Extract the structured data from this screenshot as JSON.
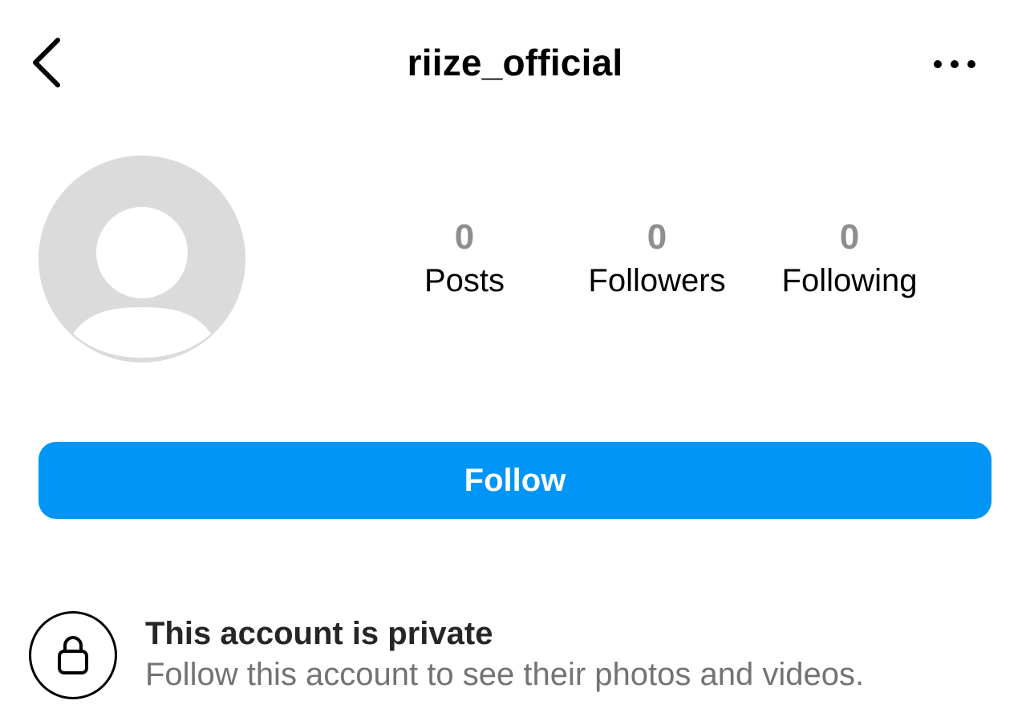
{
  "header": {
    "back_icon": "chevron-left-icon",
    "username": "riize_official",
    "more_icon": "more-horizontal-icon"
  },
  "profile": {
    "avatar_icon": "default-avatar-icon",
    "stats": [
      {
        "count": "0",
        "label": "Posts"
      },
      {
        "count": "0",
        "label": "Followers"
      },
      {
        "count": "0",
        "label": "Following"
      }
    ]
  },
  "actions": {
    "follow_label": "Follow",
    "follow_color": "#0095f6"
  },
  "private_notice": {
    "icon": "lock-icon",
    "title": "This account is private",
    "subtitle": "Follow this account to see their photos and videos."
  },
  "colors": {
    "avatar_bg": "#dbdbdb",
    "stat_count": "#8e8e8e",
    "muted_text": "#737373"
  }
}
